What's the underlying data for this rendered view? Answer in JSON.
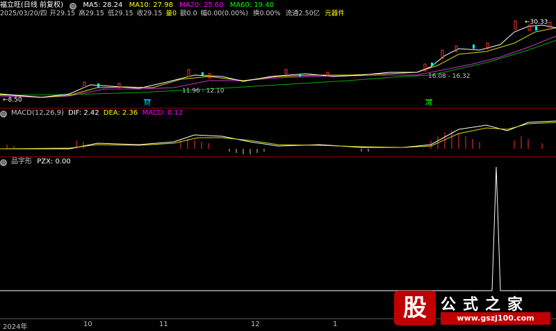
{
  "header": {
    "stock_label": "福立旺(日线 前复权)",
    "ma5": "MA5: 28.24",
    "ma10": "MA10: 27.98",
    "ma20": "MA20: 25.60",
    "ma60": "MA60: 19.40"
  },
  "info_line": {
    "date": "2025/03/20/四",
    "open": "开29.15",
    "high": "高29.15",
    "low": "低29.15",
    "close": "收29.15",
    "volume": "量0",
    "amount": "额0.0",
    "change": "幅0.00(0.00%)",
    "turnover": "换0.00%",
    "float": "流通2.50亿",
    "sector": "元器件"
  },
  "price_annotations": {
    "high_marker": "30.33",
    "low_marker": "8.50",
    "range_a": "11.96 - 12.10",
    "range_b": "16.08 - 16.32",
    "badge_cai": "财",
    "badge_jian": "减"
  },
  "macd_panel": {
    "label": "MACD(12,26,9)",
    "dif": "DIF: 2.42",
    "dea": "DEA: 2.36",
    "macd": "MACD: 0.12"
  },
  "pzx_panel": {
    "label": "品字形",
    "value": "PZX: 0.00"
  },
  "time_axis": {
    "labels": [
      "2024年",
      "10",
      "11",
      "12",
      "1"
    ]
  },
  "watermark": {
    "left_glyph": "股",
    "brand": "公式之家",
    "url": "www.gszj100.com"
  },
  "colors": {
    "ma5": "#ffffff",
    "ma10": "#ffff00",
    "ma20": "#ff00ff",
    "ma60": "#00ff00",
    "up": "#ff3333",
    "down": "#00ffff",
    "separator": "#8b0000"
  }
}
